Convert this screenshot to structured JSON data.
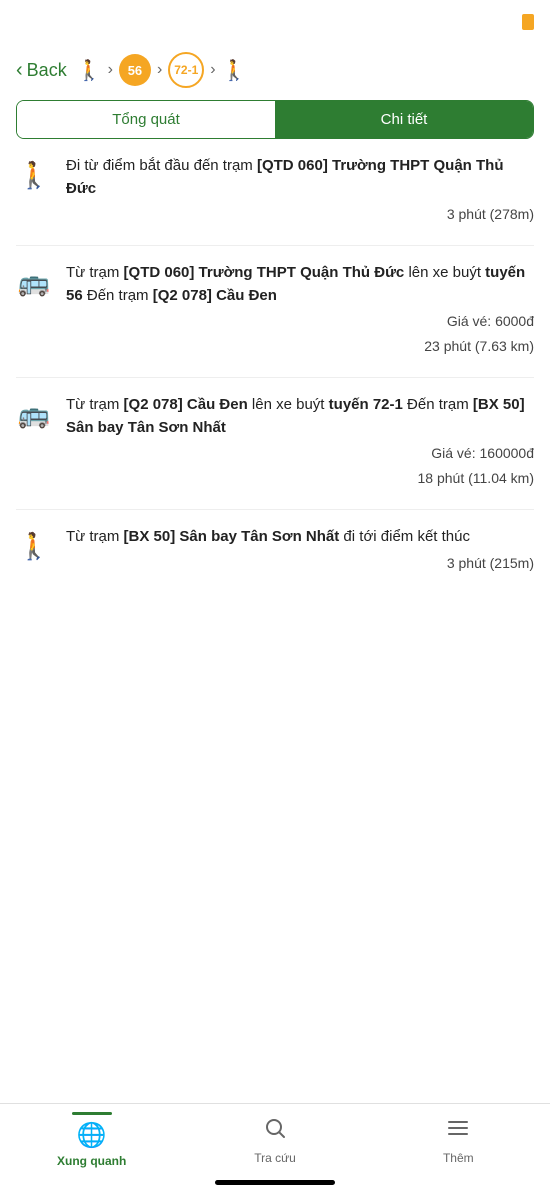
{
  "statusBar": {
    "batteryColor": "#f5a623"
  },
  "header": {
    "backLabel": "Back",
    "routeSteps": [
      {
        "type": "walk"
      },
      {
        "type": "arrow"
      },
      {
        "type": "badge",
        "label": "56",
        "style": "filled"
      },
      {
        "type": "arrow"
      },
      {
        "type": "badge",
        "label": "72-1",
        "style": "outlined"
      },
      {
        "type": "arrow"
      },
      {
        "type": "walk"
      }
    ]
  },
  "tabs": [
    {
      "id": "tong-quat",
      "label": "Tổng quát",
      "active": false
    },
    {
      "id": "chi-tiet",
      "label": "Chi tiết",
      "active": true
    }
  ],
  "steps": [
    {
      "id": "step-1",
      "iconType": "walk",
      "text": "Đi từ điểm bắt đầu đến trạm ",
      "boldPart": "[QTD 060] Trường THPT Quận Thủ Đức",
      "meta": [
        "3 phút (278m)"
      ]
    },
    {
      "id": "step-2",
      "iconType": "bus",
      "text": "Từ trạm ",
      "boldPart1": "[QTD 060] Trường THPT Quận Thủ Đức",
      "text2": " lên xe buýt ",
      "boldPart2": "tuyến 56",
      "text3": " Đến trạm ",
      "boldPart3": "[Q2 078] Cầu Đen",
      "meta": [
        "Giá vé: 6000đ",
        "23 phút (7.63 km)"
      ]
    },
    {
      "id": "step-3",
      "iconType": "bus",
      "text": "Từ trạm ",
      "boldPart1": "[Q2 078] Cầu Đen",
      "text2": " lên xe buýt ",
      "boldPart2": "tuyến 72-1",
      "text3": " Đến trạm ",
      "boldPart3": "[BX 50] Sân bay Tân Sơn Nhất",
      "meta": [
        "Giá vé: 160000đ",
        "18 phút (11.04 km)"
      ]
    },
    {
      "id": "step-4",
      "iconType": "walk",
      "text": "Từ trạm ",
      "boldPart1": "[BX 50] Sân bay Tân Sơn Nhất",
      "text2": " đi tới điểm kết thúc",
      "meta": [
        "3 phút (215m)"
      ]
    }
  ],
  "bottomNav": [
    {
      "id": "xung-quanh",
      "label": "Xung quanh",
      "icon": "🌐",
      "active": true
    },
    {
      "id": "tra-cuu",
      "label": "Tra cứu",
      "icon": "🔍",
      "active": false
    },
    {
      "id": "them",
      "label": "Thêm",
      "icon": "≡",
      "active": false
    }
  ]
}
